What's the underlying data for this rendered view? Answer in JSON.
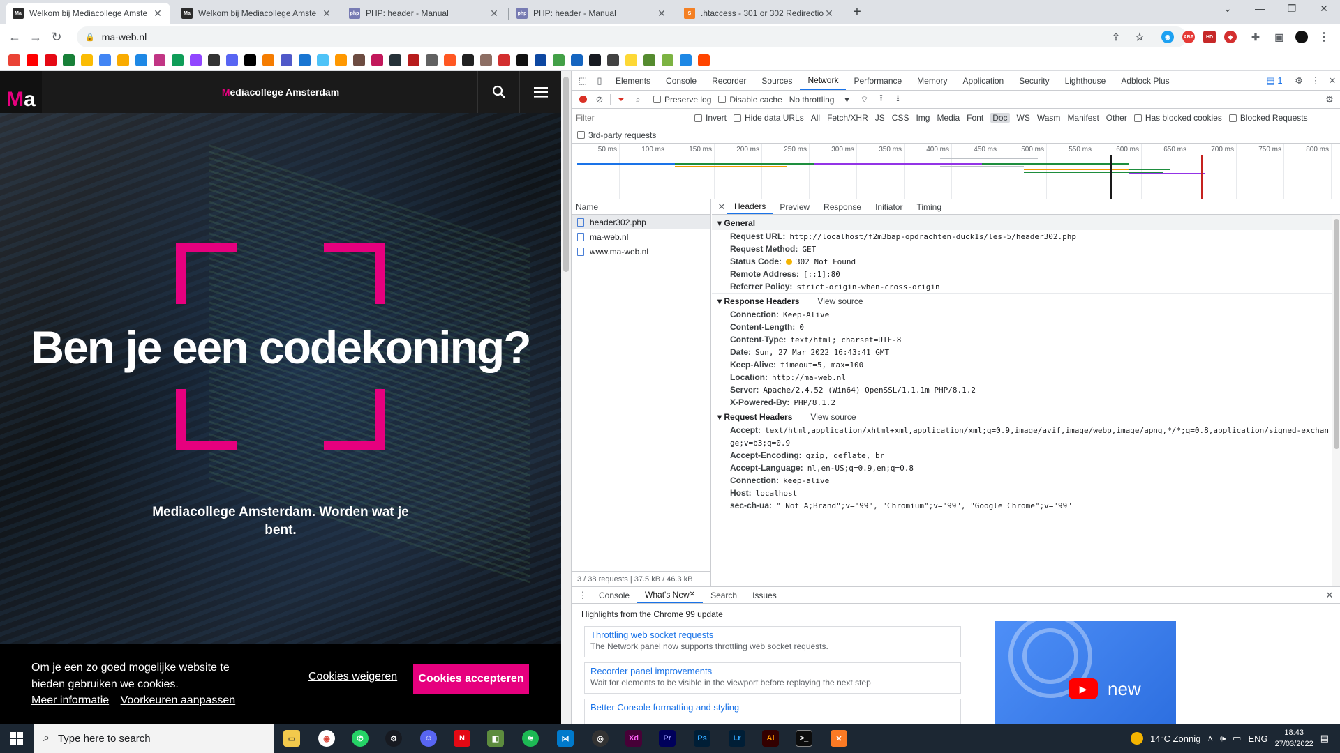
{
  "browser": {
    "tabs": [
      {
        "title": "Welkom bij Mediacollege Amste",
        "active": true
      },
      {
        "title": "Welkom bij Mediacollege Amste",
        "active": false
      },
      {
        "title": "PHP: header - Manual",
        "active": false
      },
      {
        "title": "PHP: header - Manual",
        "active": false
      },
      {
        "title": ".htaccess - 301 or 302 Redirectio",
        "active": false
      }
    ],
    "url": "ma-web.nl"
  },
  "page": {
    "logo": {
      "m": "M",
      "a": "a"
    },
    "site_title_first": "M",
    "site_title_rest": "ediacollege Amsterdam",
    "headline": "Ben je een codekoning?",
    "tagline": "Mediacollege Amsterdam. Worden wat je bent.",
    "cookie": {
      "text": "Om je een zo goed mogelijke website te bieden gebruiken we cookies.",
      "more_info": "Meer informatie",
      "preferences": "Voorkeuren aanpassen",
      "refuse": "Cookies weigeren",
      "accept": "Cookies accepteren"
    }
  },
  "devtools": {
    "tabs": [
      "Elements",
      "Console",
      "Recorder",
      "Sources",
      "Network",
      "Performance",
      "Memory",
      "Application",
      "Security",
      "Lighthouse",
      "Adblock Plus"
    ],
    "selected_tab": "Network",
    "issues_count": "1",
    "toolbar": {
      "preserve_log": "Preserve log",
      "disable_cache": "Disable cache",
      "throttling": "No throttling"
    },
    "filter": {
      "placeholder": "Filter",
      "invert": "Invert",
      "hide_data_urls": "Hide data URLs",
      "types": [
        "All",
        "Fetch/XHR",
        "JS",
        "CSS",
        "Img",
        "Media",
        "Font",
        "Doc",
        "WS",
        "Wasm",
        "Manifest",
        "Other"
      ],
      "selected_type": "Doc",
      "has_blocked_cookies": "Has blocked cookies",
      "blocked_requests": "Blocked Requests",
      "third_party": "3rd-party requests"
    },
    "timeline_ticks": [
      "50 ms",
      "100 ms",
      "150 ms",
      "200 ms",
      "250 ms",
      "300 ms",
      "350 ms",
      "400 ms",
      "450 ms",
      "500 ms",
      "550 ms",
      "600 ms",
      "650 ms",
      "700 ms",
      "750 ms",
      "800 ms"
    ],
    "name_header": "Name",
    "requests": [
      "header302.php",
      "ma-web.nl",
      "www.ma-web.nl"
    ],
    "summary": "3 / 38 requests  |  37.5 kB / 46.3 kB",
    "detail_tabs": [
      "Headers",
      "Preview",
      "Response",
      "Initiator",
      "Timing"
    ],
    "general": {
      "title": "General",
      "rows": [
        {
          "k": "Request URL:",
          "v": "http://localhost/f2m3bap-opdrachten-duck1s/les-5/header302.php"
        },
        {
          "k": "Request Method:",
          "v": "GET"
        },
        {
          "k": "Status Code:",
          "v": "302 Not Found"
        },
        {
          "k": "Remote Address:",
          "v": "[::1]:80"
        },
        {
          "k": "Referrer Policy:",
          "v": "strict-origin-when-cross-origin"
        }
      ]
    },
    "response_headers": {
      "title": "Response Headers",
      "view_source": "View source",
      "rows": [
        {
          "k": "Connection:",
          "v": "Keep-Alive"
        },
        {
          "k": "Content-Length:",
          "v": "0"
        },
        {
          "k": "Content-Type:",
          "v": "text/html; charset=UTF-8"
        },
        {
          "k": "Date:",
          "v": "Sun, 27 Mar 2022 16:43:41 GMT"
        },
        {
          "k": "Keep-Alive:",
          "v": "timeout=5, max=100"
        },
        {
          "k": "Location:",
          "v": "http://ma-web.nl"
        },
        {
          "k": "Server:",
          "v": "Apache/2.4.52 (Win64) OpenSSL/1.1.1m PHP/8.1.2"
        },
        {
          "k": "X-Powered-By:",
          "v": "PHP/8.1.2"
        }
      ]
    },
    "request_headers": {
      "title": "Request Headers",
      "view_source": "View source",
      "rows": [
        {
          "k": "Accept:",
          "v": "text/html,application/xhtml+xml,application/xml;q=0.9,image/avif,image/webp,image/apng,*/*;q=0.8,application/signed-exchan"
        },
        {
          "k": "",
          "v": "ge;v=b3;q=0.9"
        },
        {
          "k": "Accept-Encoding:",
          "v": "gzip, deflate, br"
        },
        {
          "k": "Accept-Language:",
          "v": "nl,en-US;q=0.9,en;q=0.8"
        },
        {
          "k": "Connection:",
          "v": "keep-alive"
        },
        {
          "k": "Host:",
          "v": "localhost"
        },
        {
          "k": "sec-ch-ua:",
          "v": "\" Not A;Brand\";v=\"99\", \"Chromium\";v=\"99\", \"Google Chrome\";v=\"99\""
        }
      ]
    },
    "drawer": {
      "tabs": [
        "Console",
        "What's New",
        "Search",
        "Issues"
      ],
      "selected": "What's New",
      "heading": "Highlights from the Chrome 99 update",
      "cards": [
        {
          "title": "Throttling web socket requests",
          "desc": "The Network panel now supports throttling web socket requests."
        },
        {
          "title": "Recorder panel improvements",
          "desc": "Wait for elements to be visible in the viewport before replaying the next step"
        },
        {
          "title": "Better Console formatting and styling",
          "desc": ""
        }
      ],
      "video_label": "new"
    }
  },
  "taskbar": {
    "search_placeholder": "Type here to search",
    "weather": "14°C  Zonnig",
    "language": "ENG",
    "time": "18:43",
    "date": "27/03/2022"
  },
  "colors": {
    "brand": "#e6007e",
    "devtools_accent": "#1a73e8"
  }
}
